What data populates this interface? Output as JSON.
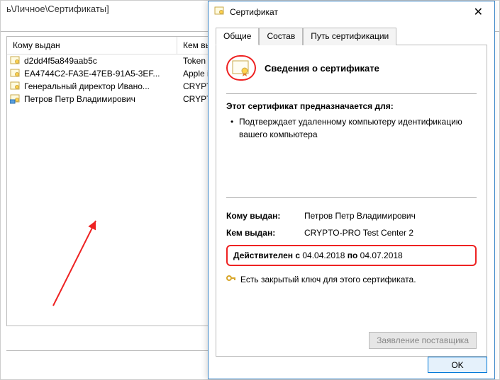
{
  "bg": {
    "title": "ь\\Личное\\Сертификаты]"
  },
  "list": {
    "headers": {
      "to": "Кому выдан",
      "by": "Кем выдан"
    },
    "rows": [
      {
        "to": "d2dd4f5a849aab5c",
        "by": "Token Signing"
      },
      {
        "to": "EA4744C2-FA3E-47EB-91A5-3EF...",
        "by": "Apple iPhone"
      },
      {
        "to": "Генеральный директор Ивано...",
        "by": "CRYPTO-PRO"
      },
      {
        "to": "Петров Петр Владимирович",
        "by": "CRYPTO-PRO"
      }
    ]
  },
  "dialog": {
    "title": "Сертификат",
    "tabs": {
      "general": "Общие",
      "details": "Состав",
      "path": "Путь сертификации"
    },
    "heading": "Сведения о сертификате",
    "purpose_title": "Этот сертификат предназначается для:",
    "purpose_item": "Подтверждает удаленному компьютеру идентификацию вашего компьютера",
    "fields": {
      "to_label": "Кому выдан:",
      "to_value": "Петров Петр Владимирович",
      "by_label": "Кем выдан:",
      "by_value": "CRYPTO-PRO Test Center 2"
    },
    "validity": {
      "prefix": "Действителен с ",
      "from": "04.04.2018",
      "mid": " по ",
      "to": "04.07.2018"
    },
    "key_note": "Есть закрытый ключ для этого сертификата.",
    "supplier_btn": "Заявление поставщика",
    "ok": "OK"
  }
}
